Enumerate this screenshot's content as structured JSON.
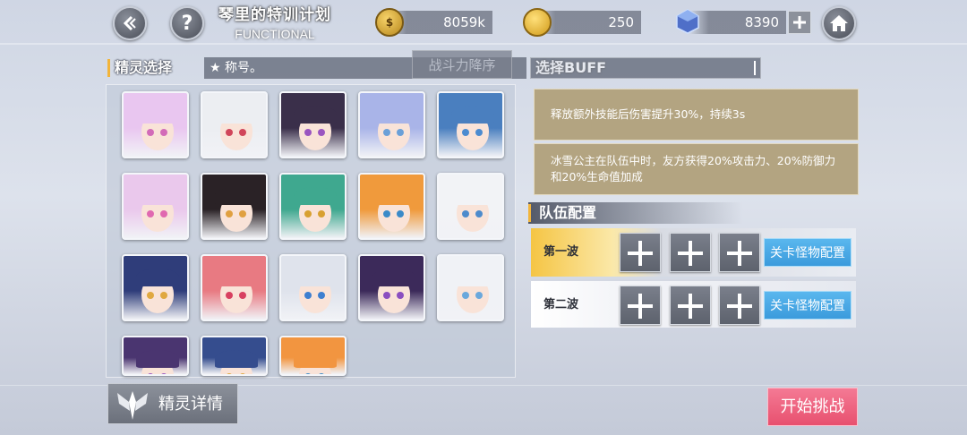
{
  "header": {
    "title": "琴里的特训计划",
    "subtitle": "FUNCTIONAL",
    "icons": [
      "back-icon",
      "help-icon",
      "home-icon"
    ]
  },
  "resources": [
    {
      "name": "gold",
      "icon": "coin-icon",
      "value": "8059k"
    },
    {
      "name": "ticket",
      "icon": "gold-coin-stack-icon",
      "value": "250"
    },
    {
      "name": "crystal",
      "icon": "crystal-icon",
      "value": "8390"
    }
  ],
  "spirit_select": {
    "heading": "精灵选择",
    "title_filter": "★ 称号。",
    "sort_label": "战斗力降序",
    "cards": [
      {
        "hair": "#e9c6f0",
        "eye": "#d26bb8"
      },
      {
        "hair": "#eceef2",
        "eye": "#d0455a"
      },
      {
        "hair": "#3a2f4a",
        "eye": "#9a55c0"
      },
      {
        "hair": "#a9b4e8",
        "eye": "#6aa0d8"
      },
      {
        "hair": "#4a7fbf",
        "eye": "#4b8bd0"
      },
      {
        "hair": "#eac8ec",
        "eye": "#e069b0"
      },
      {
        "hair": "#2a2226",
        "eye": "#e0a040"
      },
      {
        "hair": "#3fa88f",
        "eye": "#d8a030"
      },
      {
        "hair": "#f09a3c",
        "eye": "#3a8ac8"
      },
      {
        "hair": "#f2f3f6",
        "eye": "#4d8bcc"
      },
      {
        "hair": "#2f3d7a",
        "eye": "#e0a840"
      },
      {
        "hair": "#e87a82",
        "eye": "#d84060"
      },
      {
        "hair": "#dfe3ec",
        "eye": "#3d7fd0"
      },
      {
        "hair": "#3c2a5a",
        "eye": "#8a4fc0"
      },
      {
        "hair": "#f0f2f6",
        "eye": "#6aa8dc"
      },
      {
        "hair": "#4a3570",
        "eye": "#9a55c0"
      },
      {
        "hair": "#354d8e",
        "eye": "#e0a840"
      },
      {
        "hair": "#f29540",
        "eye": "#3a8ac8"
      }
    ]
  },
  "buff": {
    "heading": "选择BUFF",
    "items": [
      "释放额外技能后伤害提升30%，持续3s",
      "冰雪公主在队伍中时，友方获得20%攻击力、20%防御力和20%生命值加成"
    ]
  },
  "team": {
    "heading": "队伍配置",
    "waves": [
      {
        "label": "第一波",
        "config_label": "关卡怪物配置",
        "active": true
      },
      {
        "label": "第二波",
        "config_label": "关卡怪物配置",
        "active": false
      }
    ]
  },
  "footer": {
    "detail_label": "精灵详情",
    "start_label": "开始挑战"
  },
  "colors": {
    "accent_gold": "#f2b43a",
    "buff_card": "#b3a481",
    "config_blue": "#3b9bdc",
    "start_pink": "#e8516f"
  }
}
